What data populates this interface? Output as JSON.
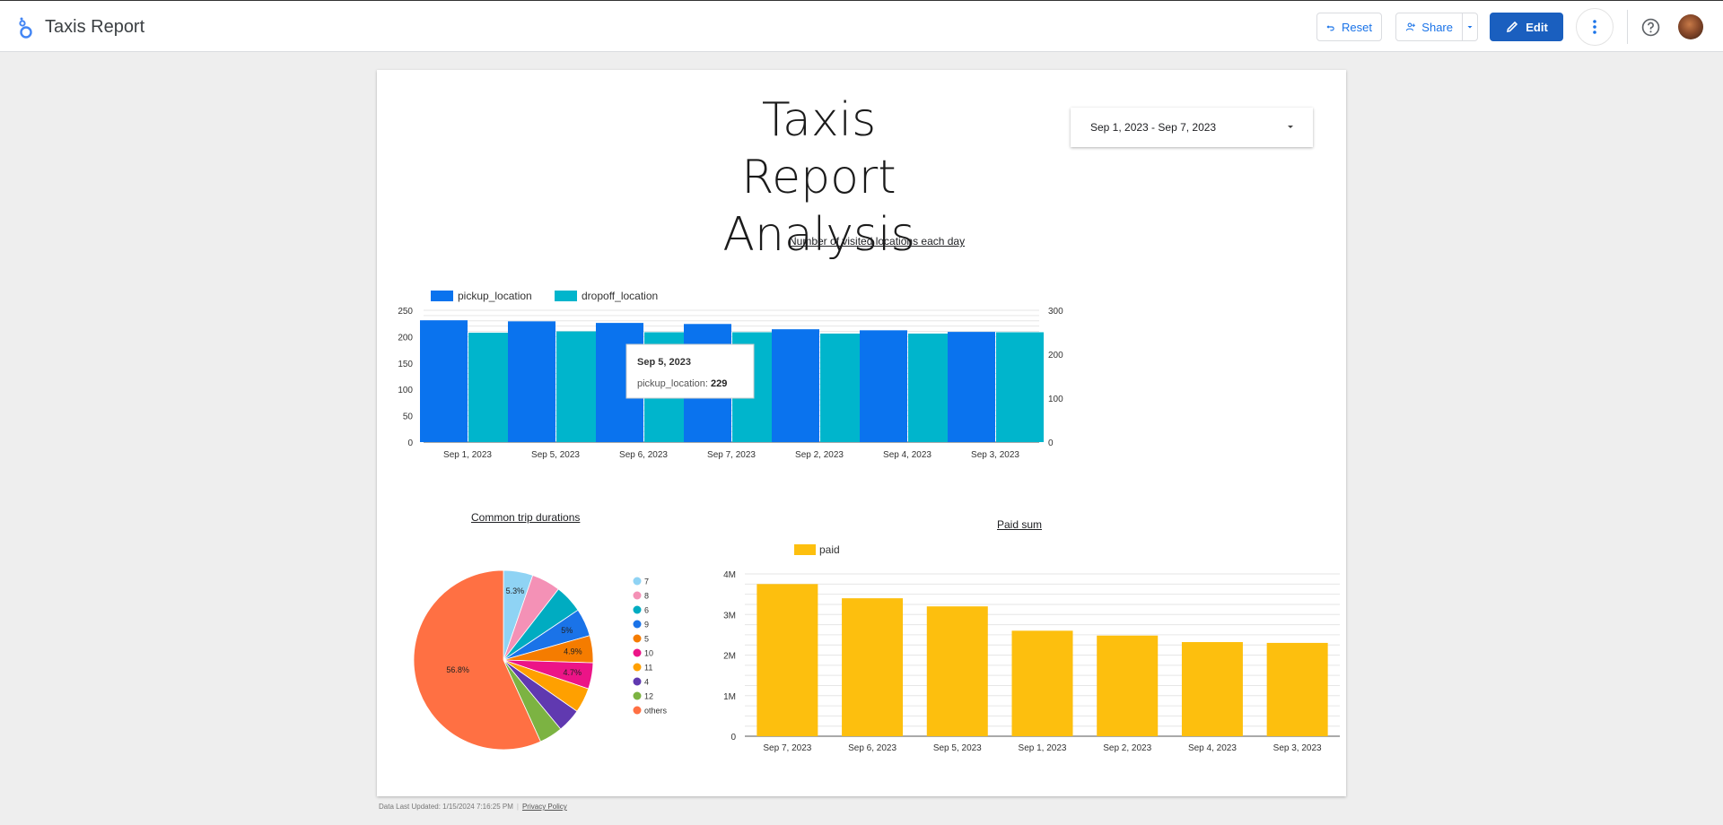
{
  "app": {
    "title": "Taxis Report"
  },
  "toolbar": {
    "reset_label": "Reset",
    "share_label": "Share",
    "edit_label": "Edit"
  },
  "report": {
    "title_line1": "Taxis Report",
    "title_line2": "Analysis",
    "date_range": "Sep 1, 2023 - Sep 7, 2023"
  },
  "footer": {
    "updated": "Data Last Updated: 1/15/2024 7:16:25 PM",
    "privacy": "Privacy Policy"
  },
  "colors": {
    "blue": "#0a73ee",
    "teal": "#00b5cc",
    "yellow": "#fdbf0e",
    "accent": "#1a5fbf"
  },
  "chart_data": [
    {
      "type": "bar",
      "title": "Number  of visited locations each day",
      "categories": [
        "Sep 1, 2023",
        "Sep 5, 2023",
        "Sep 6, 2023",
        "Sep 7, 2023",
        "Sep 2, 2023",
        "Sep 4, 2023",
        "Sep 3, 2023"
      ],
      "series": [
        {
          "name": "pickup_location",
          "axis": "left",
          "color": "#0a73ee",
          "values": [
            231,
            229,
            226,
            224,
            214,
            212,
            209
          ]
        },
        {
          "name": "dropoff_location",
          "axis": "right",
          "color": "#00b5cc",
          "values": [
            249,
            252,
            250,
            250,
            247,
            247,
            250
          ]
        }
      ],
      "ylim_left": [
        0,
        250
      ],
      "yticks_left": [
        "0",
        "50",
        "100",
        "150",
        "200",
        "250"
      ],
      "ylim_right": [
        0,
        300
      ],
      "yticks_right": [
        "0",
        "100",
        "200",
        "300"
      ],
      "legend": "top-left",
      "grid": true,
      "tooltip": {
        "title": "Sep 5, 2023",
        "label": "pickup_location: ",
        "value": "229"
      }
    },
    {
      "type": "pie",
      "title": "Common trip durations",
      "slices": [
        {
          "label": "7",
          "value": 5.3,
          "color": "#8fd3f4",
          "pct_label": "5.3%"
        },
        {
          "label": "8",
          "value": 5.2,
          "color": "#f491b6",
          "pct_label": ""
        },
        {
          "label": "6",
          "value": 5.1,
          "color": "#00acc1",
          "pct_label": ""
        },
        {
          "label": "9",
          "value": 5.0,
          "color": "#1a73e8",
          "pct_label": "5%"
        },
        {
          "label": "5",
          "value": 4.9,
          "color": "#f57c00",
          "pct_label": "4.9%"
        },
        {
          "label": "10",
          "value": 4.7,
          "color": "#ec1487",
          "pct_label": "4.7%"
        },
        {
          "label": "11",
          "value": 4.5,
          "color": "#ffa000",
          "pct_label": ""
        },
        {
          "label": "4",
          "value": 4.3,
          "color": "#6039b0",
          "pct_label": ""
        },
        {
          "label": "12",
          "value": 4.2,
          "color": "#7cb342",
          "pct_label": ""
        },
        {
          "label": "others",
          "value": 56.8,
          "color": "#ff7043",
          "pct_label": "56.8%"
        }
      ],
      "legend": "right"
    },
    {
      "type": "bar",
      "title": "Paid sum",
      "categories": [
        "Sep 7, 2023",
        "Sep 6, 2023",
        "Sep 5, 2023",
        "Sep 1, 2023",
        "Sep 2, 2023",
        "Sep 4, 2023",
        "Sep 3, 2023"
      ],
      "series": [
        {
          "name": "paid",
          "color": "#fdbf0e",
          "values": [
            3750000,
            3400000,
            3200000,
            2600000,
            2480000,
            2320000,
            2300000
          ]
        }
      ],
      "ylim": [
        0,
        4000000
      ],
      "yticks": [
        "0",
        "1M",
        "2M",
        "3M",
        "4M"
      ],
      "legend": "top-left",
      "grid": true
    }
  ]
}
